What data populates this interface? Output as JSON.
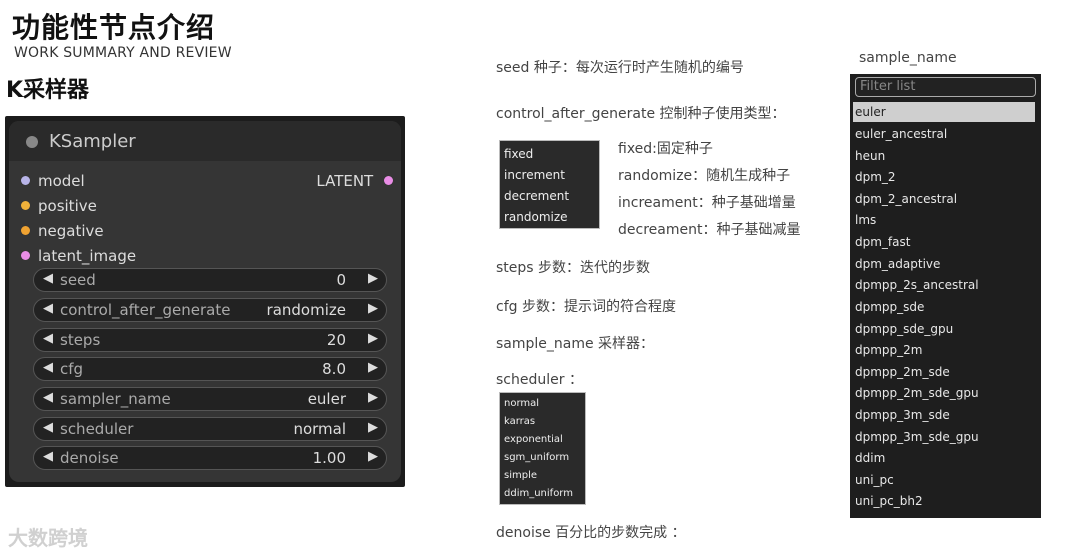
{
  "header": {
    "title": "功能性节点介绍",
    "subtitle": "WORK SUMMARY AND REVIEW",
    "section": "K采样器"
  },
  "node": {
    "title": "KSampler",
    "inputs": [
      {
        "label": "model",
        "color": "#b8b4e8"
      },
      {
        "label": "positive",
        "color": "#f0b13a"
      },
      {
        "label": "negative",
        "color": "#f0a332"
      },
      {
        "label": "latent_image",
        "color": "#e98de6"
      }
    ],
    "output": {
      "label": "LATENT",
      "color": "#e98de6"
    },
    "widgets": [
      {
        "label": "seed",
        "value": "0"
      },
      {
        "label": "control_after_generate",
        "value": "randomize"
      },
      {
        "label": "steps",
        "value": "20"
      },
      {
        "label": "cfg",
        "value": "8.0"
      },
      {
        "label": "sampler_name",
        "value": "euler"
      },
      {
        "label": "scheduler",
        "value": "normal"
      },
      {
        "label": "denoise",
        "value": "1.00"
      }
    ],
    "arrow_left": "◀",
    "arrow_right": "▶"
  },
  "watermark": "大数跨境",
  "descriptions": {
    "seed": "seed 种子：每次运行时产生随机的编号",
    "control": "control_after_generate 控制种子使用类型：",
    "steps": "steps 步数：迭代的步数",
    "cfg": "cfg 步数：提示词的符合程度",
    "sampler": "sample_name 采样器：",
    "scheduler": "scheduler ：",
    "denoise": "denoise 百分比的步数完成 ："
  },
  "control_options": [
    "fixed",
    "increment",
    "decrement",
    "randomize"
  ],
  "control_option_desc": [
    "fixed:固定种子",
    "randomize：随机生成种子",
    "increament：种子基础增量",
    "decreament：种子基础减量"
  ],
  "scheduler_options": [
    "normal",
    "karras",
    "exponential",
    "sgm_uniform",
    "simple",
    "ddim_uniform"
  ],
  "sampler_dropdown": {
    "title": "sample_name",
    "filter_placeholder": "Filter list",
    "selected": "euler",
    "items": [
      "euler",
      "euler_ancestral",
      "heun",
      "dpm_2",
      "dpm_2_ancestral",
      "lms",
      "dpm_fast",
      "dpm_adaptive",
      "dpmpp_2s_ancestral",
      "dpmpp_sde",
      "dpmpp_sde_gpu",
      "dpmpp_2m",
      "dpmpp_2m_sde",
      "dpmpp_2m_sde_gpu",
      "dpmpp_3m_sde",
      "dpmpp_3m_sde_gpu",
      "ddim",
      "uni_pc",
      "uni_pc_bh2"
    ]
  }
}
